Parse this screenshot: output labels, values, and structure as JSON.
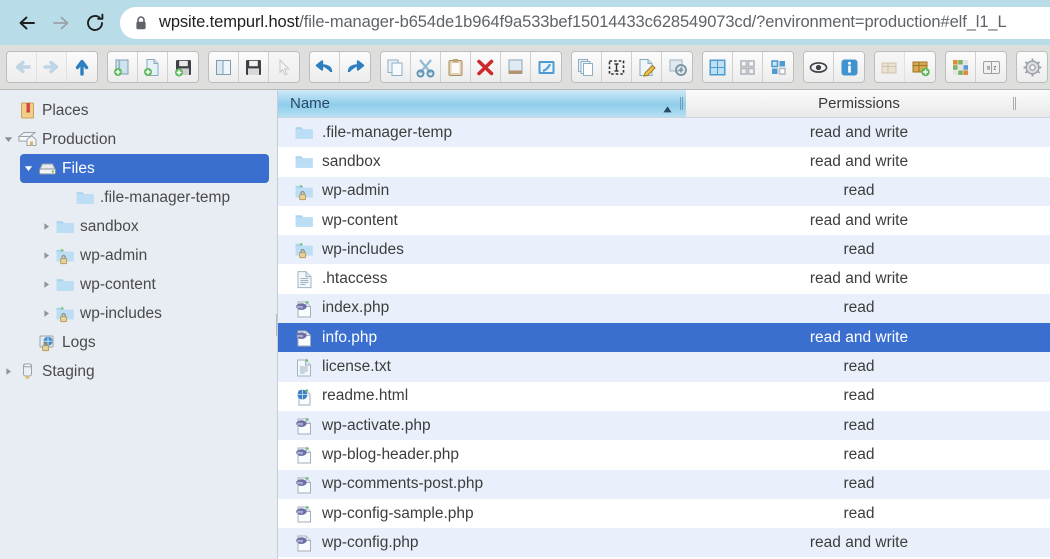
{
  "browser": {
    "back_label": "Back",
    "forward_label": "Forward",
    "reload_label": "Reload",
    "lock_label": "View site information",
    "url_host": "wpsite.tempurl.host",
    "url_path": "/file-manager-b654de1b964f9a533bef15014433c628549073cd/?environment=production#elf_l1_L",
    "url_full": "wpsite.tempurl.host/file-manager-b654de1b964f9a533bef15014433c628549073cd/?environment=production#elf_l1_L"
  },
  "toolbar": {
    "groups": [
      {
        "name": "navigation",
        "buttons": [
          {
            "name": "back-button",
            "icon": "arrow-left-icon",
            "label": "Back",
            "disabled": true
          },
          {
            "name": "forward-button",
            "icon": "arrow-right-icon",
            "label": "Forward",
            "disabled": true
          },
          {
            "name": "up-button",
            "icon": "arrow-up-icon",
            "label": "Up",
            "disabled": false
          }
        ]
      },
      {
        "name": "create",
        "buttons": [
          {
            "name": "new-folder-button",
            "icon": "folder-add-icon",
            "label": "New folder",
            "disabled": false
          },
          {
            "name": "new-file-button",
            "icon": "file-add-icon",
            "label": "New file",
            "disabled": false
          },
          {
            "name": "upload-button",
            "icon": "upload-disk-icon",
            "label": "Upload files",
            "disabled": false
          }
        ]
      },
      {
        "name": "open",
        "buttons": [
          {
            "name": "open-button",
            "icon": "open-book-icon",
            "label": "Open",
            "disabled": false
          },
          {
            "name": "download-button",
            "icon": "download-disk-icon",
            "label": "Download",
            "disabled": false
          },
          {
            "name": "select-button",
            "icon": "cursor-icon",
            "label": "Select",
            "disabled": true
          }
        ]
      },
      {
        "name": "history",
        "buttons": [
          {
            "name": "undo-button",
            "icon": "undo-icon",
            "label": "Undo",
            "disabled": false
          },
          {
            "name": "redo-button",
            "icon": "redo-icon",
            "label": "Redo",
            "disabled": false
          }
        ]
      },
      {
        "name": "clipboard",
        "buttons": [
          {
            "name": "copy-button",
            "icon": "copy-icon",
            "label": "Copy",
            "disabled": false
          },
          {
            "name": "cut-button",
            "icon": "scissors-icon",
            "label": "Cut",
            "disabled": false
          },
          {
            "name": "paste-button",
            "icon": "clipboard-icon",
            "label": "Paste",
            "disabled": false
          },
          {
            "name": "delete-button",
            "icon": "red-x-icon",
            "label": "Delete",
            "disabled": false
          },
          {
            "name": "empty-folder-button",
            "icon": "empty-folder-icon",
            "label": "Empty folder",
            "disabled": false
          },
          {
            "name": "preview-button",
            "icon": "quicklook-icon",
            "label": "Preview",
            "disabled": false
          }
        ]
      },
      {
        "name": "edit",
        "buttons": [
          {
            "name": "duplicate-button",
            "icon": "duplicate-icon",
            "label": "Duplicate",
            "disabled": false
          },
          {
            "name": "rename-button",
            "icon": "rename-box-icon",
            "label": "Rename",
            "disabled": false
          },
          {
            "name": "edit-file-button",
            "icon": "edit-pencil-icon",
            "label": "Edit file",
            "disabled": false
          },
          {
            "name": "resize-image-button",
            "icon": "resize-image-icon",
            "label": "Resize & Rotate",
            "disabled": false
          }
        ]
      },
      {
        "name": "view",
        "buttons": [
          {
            "name": "view-list-button",
            "icon": "view-list-icon",
            "label": "List view",
            "disabled": false,
            "active": true
          },
          {
            "name": "view-icons-button",
            "icon": "view-icons-icon",
            "label": "Icons view",
            "disabled": false
          },
          {
            "name": "view-mixed-button",
            "icon": "view-mixed-icon",
            "label": "Mixed view",
            "disabled": false
          }
        ]
      },
      {
        "name": "info",
        "buttons": [
          {
            "name": "toggle-hidden-button",
            "icon": "eye-icon",
            "label": "Show hidden files",
            "disabled": false
          },
          {
            "name": "get-info-button",
            "icon": "info-icon",
            "label": "Get info",
            "disabled": false
          }
        ]
      },
      {
        "name": "archive",
        "buttons": [
          {
            "name": "extract-archive-button",
            "icon": "archive-extract-icon",
            "label": "Extract archive",
            "disabled": true
          },
          {
            "name": "create-archive-button",
            "icon": "archive-create-icon",
            "label": "Create archive",
            "disabled": false
          }
        ]
      },
      {
        "name": "tools",
        "buttons": [
          {
            "name": "chmod-button",
            "icon": "permissions-grid-icon",
            "label": "Change permissions",
            "disabled": false
          },
          {
            "name": "search-button",
            "icon": "dictionary-icon",
            "label": "Search",
            "disabled": false
          }
        ]
      },
      {
        "name": "preferences",
        "buttons": [
          {
            "name": "settings-button",
            "icon": "gear-icon",
            "label": "Preferences",
            "disabled": false
          }
        ]
      }
    ]
  },
  "sidebar": {
    "items": [
      {
        "label": "Places",
        "icon": "places-bookmark-icon",
        "indent": 0,
        "arrow": "none",
        "selected": false
      },
      {
        "label": "Production",
        "icon": "server-home-icon",
        "indent": 0,
        "arrow": "expanded",
        "selected": false
      },
      {
        "label": "Files",
        "icon": "drive-icon",
        "indent": 1,
        "arrow": "expanded",
        "selected": true
      },
      {
        "label": ".file-manager-temp",
        "icon": "folder-icon",
        "indent": 3,
        "arrow": "none",
        "selected": false
      },
      {
        "label": "sandbox",
        "icon": "folder-icon",
        "indent": 2,
        "arrow": "collapsed",
        "selected": false
      },
      {
        "label": "wp-admin",
        "icon": "folder-locked-icon",
        "indent": 2,
        "arrow": "collapsed",
        "selected": false
      },
      {
        "label": "wp-content",
        "icon": "folder-icon",
        "indent": 2,
        "arrow": "collapsed",
        "selected": false
      },
      {
        "label": "wp-includes",
        "icon": "folder-locked-icon",
        "indent": 2,
        "arrow": "collapsed",
        "selected": false
      },
      {
        "label": "Logs",
        "icon": "logs-locked-icon",
        "indent": 1,
        "arrow": "none",
        "selected": false
      },
      {
        "label": "Staging",
        "icon": "staging-drive-icon",
        "indent": 0,
        "arrow": "collapsed",
        "selected": false
      }
    ]
  },
  "filelist": {
    "columns": [
      {
        "label": "Name",
        "name": "column-header-name",
        "sorted": true,
        "sort_dir": "asc"
      },
      {
        "label": "Permissions",
        "name": "column-header-permissions",
        "sorted": false,
        "sort_dir": ""
      }
    ],
    "rows": [
      {
        "name": ".file-manager-temp",
        "permissions": "read and write",
        "icon": "folder-icon",
        "selected": false
      },
      {
        "name": "sandbox",
        "permissions": "read and write",
        "icon": "folder-icon",
        "selected": false
      },
      {
        "name": "wp-admin",
        "permissions": "read",
        "icon": "folder-locked-icon",
        "selected": false
      },
      {
        "name": "wp-content",
        "permissions": "read and write",
        "icon": "folder-icon",
        "selected": false
      },
      {
        "name": "wp-includes",
        "permissions": "read",
        "icon": "folder-locked-icon",
        "selected": false
      },
      {
        "name": ".htaccess",
        "permissions": "read and write",
        "icon": "text-file-icon",
        "selected": false
      },
      {
        "name": "index.php",
        "permissions": "read",
        "icon": "php-file-icon",
        "selected": false
      },
      {
        "name": "info.php",
        "permissions": "read and write",
        "icon": "php-file-icon",
        "selected": true
      },
      {
        "name": "license.txt",
        "permissions": "read",
        "icon": "text-file-icon",
        "selected": false
      },
      {
        "name": "readme.html",
        "permissions": "read",
        "icon": "html-file-icon",
        "selected": false
      },
      {
        "name": "wp-activate.php",
        "permissions": "read",
        "icon": "php-file-icon",
        "selected": false
      },
      {
        "name": "wp-blog-header.php",
        "permissions": "read",
        "icon": "php-file-icon",
        "selected": false
      },
      {
        "name": "wp-comments-post.php",
        "permissions": "read",
        "icon": "php-file-icon",
        "selected": false
      },
      {
        "name": "wp-config-sample.php",
        "permissions": "read",
        "icon": "php-file-icon",
        "selected": false
      },
      {
        "name": "wp-config.php",
        "permissions": "read and write",
        "icon": "php-file-icon",
        "selected": false
      }
    ]
  },
  "colors": {
    "browser_bar": "#b8dde9",
    "selection": "#3a6fd0",
    "toolbar_bg": "#dededd",
    "sidebar_bg": "#e8edf3",
    "row_stripe": "#eaf0fb",
    "header_blue": "#8fcdec"
  }
}
